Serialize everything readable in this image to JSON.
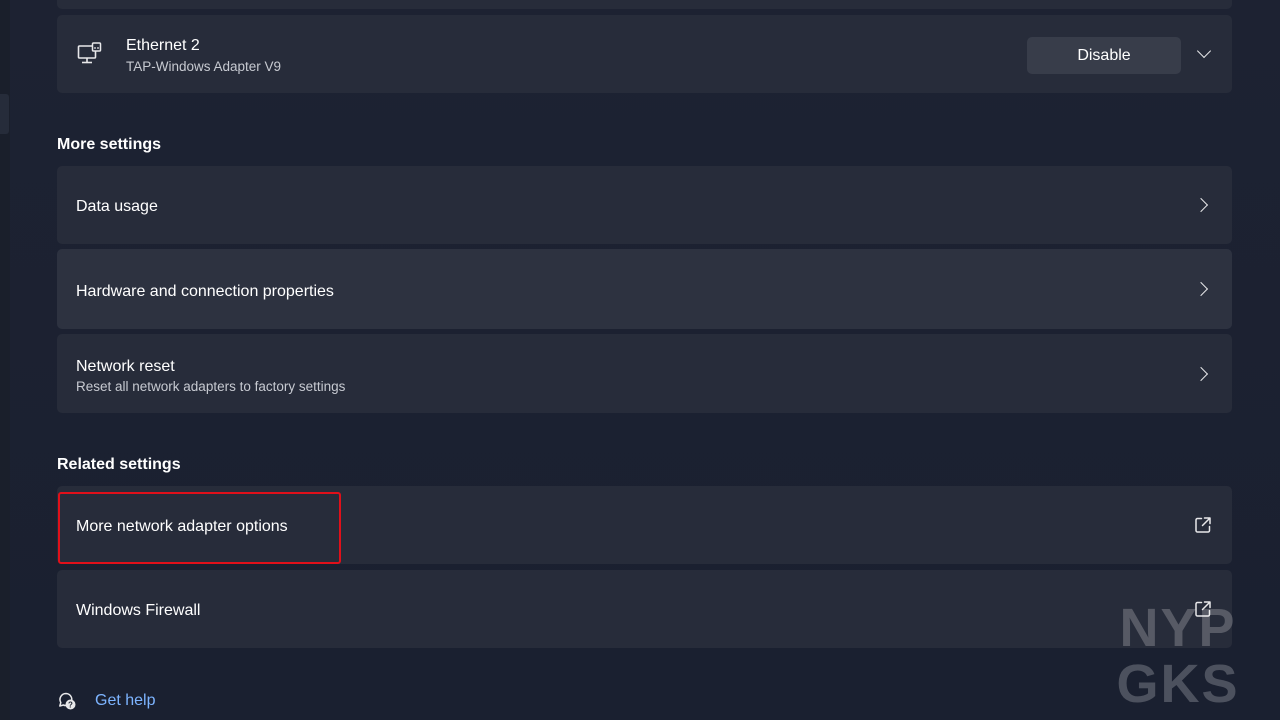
{
  "adapter": {
    "name": "Ethernet 2",
    "description": "TAP-Windows Adapter V9",
    "disable_label": "Disable"
  },
  "more_settings": {
    "heading": "More settings",
    "items": [
      {
        "title": "Data usage"
      },
      {
        "title": "Hardware and connection properties"
      },
      {
        "title": "Network reset",
        "subtitle": "Reset all network adapters to factory settings"
      }
    ]
  },
  "related_settings": {
    "heading": "Related settings",
    "items": [
      {
        "title": "More network adapter options"
      },
      {
        "title": "Windows Firewall"
      }
    ]
  },
  "help": {
    "label": "Get help"
  },
  "watermark": {
    "line1": "NYP",
    "line2": "GKS"
  },
  "colors": {
    "background": "#1c2230",
    "card": "#272c3a",
    "link": "#7db4ff",
    "highlight": "#e0101a"
  }
}
